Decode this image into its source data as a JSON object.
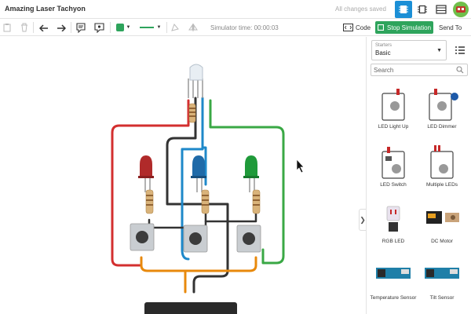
{
  "topbar": {
    "title": "Amazing Laser Tachyon",
    "save_status": "All changes saved"
  },
  "toolbar": {
    "color_value": "#2ea45c",
    "simulator_time": "Simulator time: 00:00:03",
    "code_label": "Code",
    "stop_label": "Stop Simulation",
    "send_label": "Send To"
  },
  "panel": {
    "starters_label": "Starters",
    "starters_value": "Basic",
    "search_placeholder": "Search",
    "components": [
      {
        "label": "LED Light Up",
        "icon": "led-light-up-icon"
      },
      {
        "label": "LED Dimmer",
        "icon": "led-dimmer-icon"
      },
      {
        "label": "LED Switch",
        "icon": "led-switch-icon"
      },
      {
        "label": "Multiple LEDs",
        "icon": "multiple-leds-icon"
      },
      {
        "label": "RGB LED",
        "icon": "rgb-led-icon"
      },
      {
        "label": "DC Motor",
        "icon": "dc-motor-icon"
      },
      {
        "label": "Temperature Sensor",
        "icon": "temperature-sensor-icon"
      },
      {
        "label": "Tilt Sensor",
        "icon": "tilt-sensor-icon"
      }
    ]
  },
  "colors": {
    "accent": "#1b8fd6",
    "stop_button": "#2ea45c",
    "wire_red": "#d32f2f",
    "wire_blue": "#1e88c9",
    "wire_green": "#3aa845",
    "wire_black": "#333333",
    "wire_orange": "#e8890c"
  }
}
